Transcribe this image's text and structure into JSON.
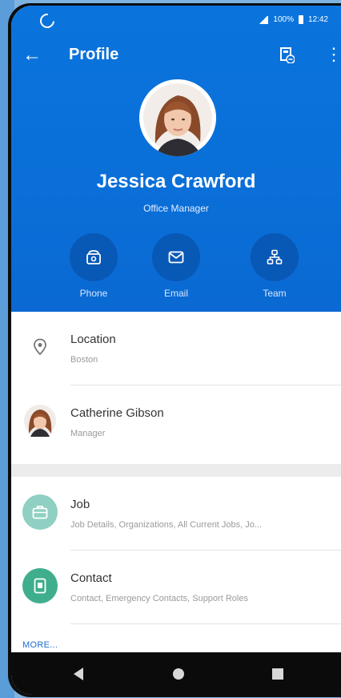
{
  "status_bar": {
    "signal_text": "100%",
    "time": "12:42"
  },
  "toolbar": {
    "title": "Profile",
    "back_icon": "arrow-left-icon",
    "org_icon": "org-chart-icon",
    "more_icon": "more-vertical-icon"
  },
  "profile": {
    "name": "Jessica Crawford",
    "role": "Office Manager"
  },
  "actions": [
    {
      "label": "Phone",
      "icon": "phone-icon"
    },
    {
      "label": "Email",
      "icon": "mail-icon"
    },
    {
      "label": "Team",
      "icon": "team-icon"
    }
  ],
  "details": [
    {
      "title": "Location",
      "subtitle": "Boston",
      "icon": "location-pin-icon"
    },
    {
      "title": "Catherine Gibson",
      "subtitle": "Manager",
      "icon": "avatar"
    }
  ],
  "sections": [
    {
      "title": "Job",
      "subtitle": "Job Details, Organizations, All Current Jobs, Jo...",
      "icon": "briefcase-icon",
      "color": "#8fd0c2"
    },
    {
      "title": "Contact",
      "subtitle": "Contact, Emergency Contacts, Support Roles",
      "icon": "contact-card-icon",
      "color": "#3fae8c"
    }
  ],
  "more_link": "MORE...",
  "colors": {
    "header_blue": "#0a70d8",
    "action_circle": "#0858b6"
  }
}
